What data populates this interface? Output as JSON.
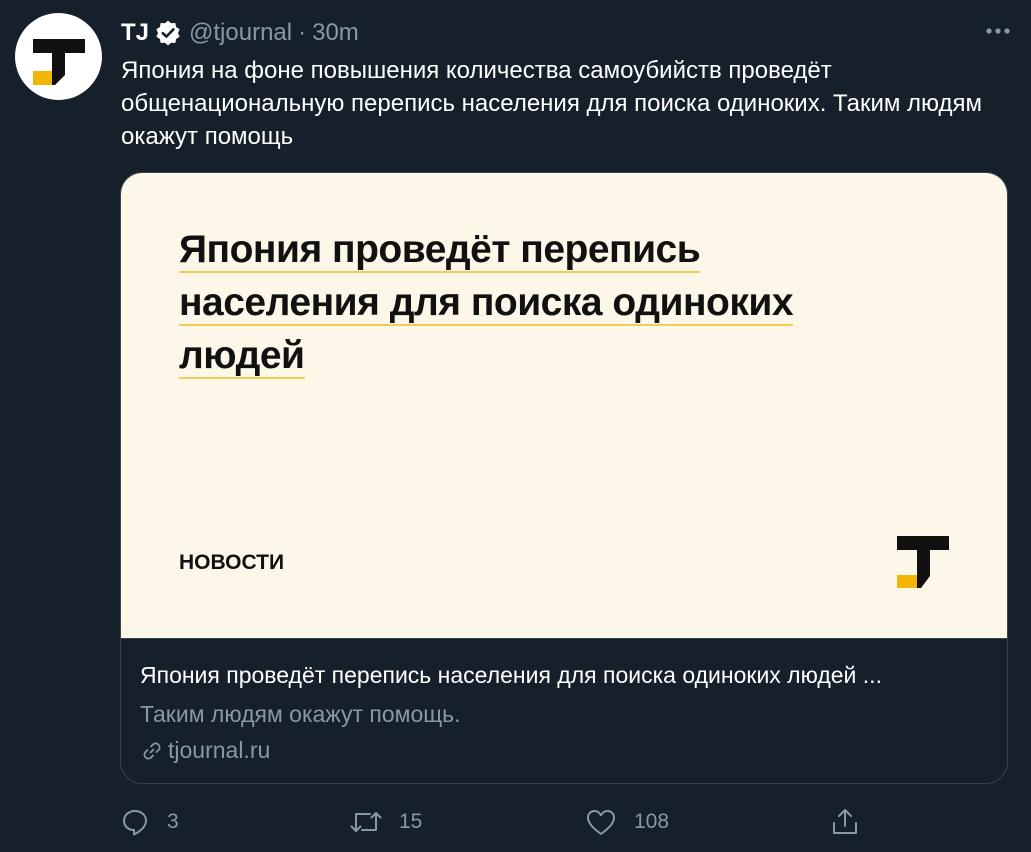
{
  "tweet": {
    "display_name": "TJ",
    "handle": "@tjournal",
    "separator": "·",
    "time": "30m",
    "text": "Япония на фоне повышения количества самоубийств проведёт общенациональную перепись населения для поиска одиноких. Таким людям окажут помощь"
  },
  "card": {
    "image": {
      "title_lines": [
        "Япония проведёт перепись",
        "населения для поиска одиноких",
        "людей"
      ],
      "category": "НОВОСТИ"
    },
    "title": "Япония проведёт перепись населения для поиска одиноких людей ...",
    "description": "Таким людям окажут помощь.",
    "domain": "tjournal.ru"
  },
  "actions": {
    "reply": {
      "icon": "reply-icon",
      "count": "3"
    },
    "retweet": {
      "icon": "retweet-icon",
      "count": "15"
    },
    "like": {
      "icon": "heart-icon",
      "count": "108"
    },
    "share": {
      "icon": "share-icon"
    }
  },
  "colors": {
    "background": "#15202b",
    "secondary_text": "#8899a6",
    "card_image_bg": "#fdf7e9",
    "accent_yellow": "#f2b705",
    "verified_badge": "#ffffff"
  }
}
